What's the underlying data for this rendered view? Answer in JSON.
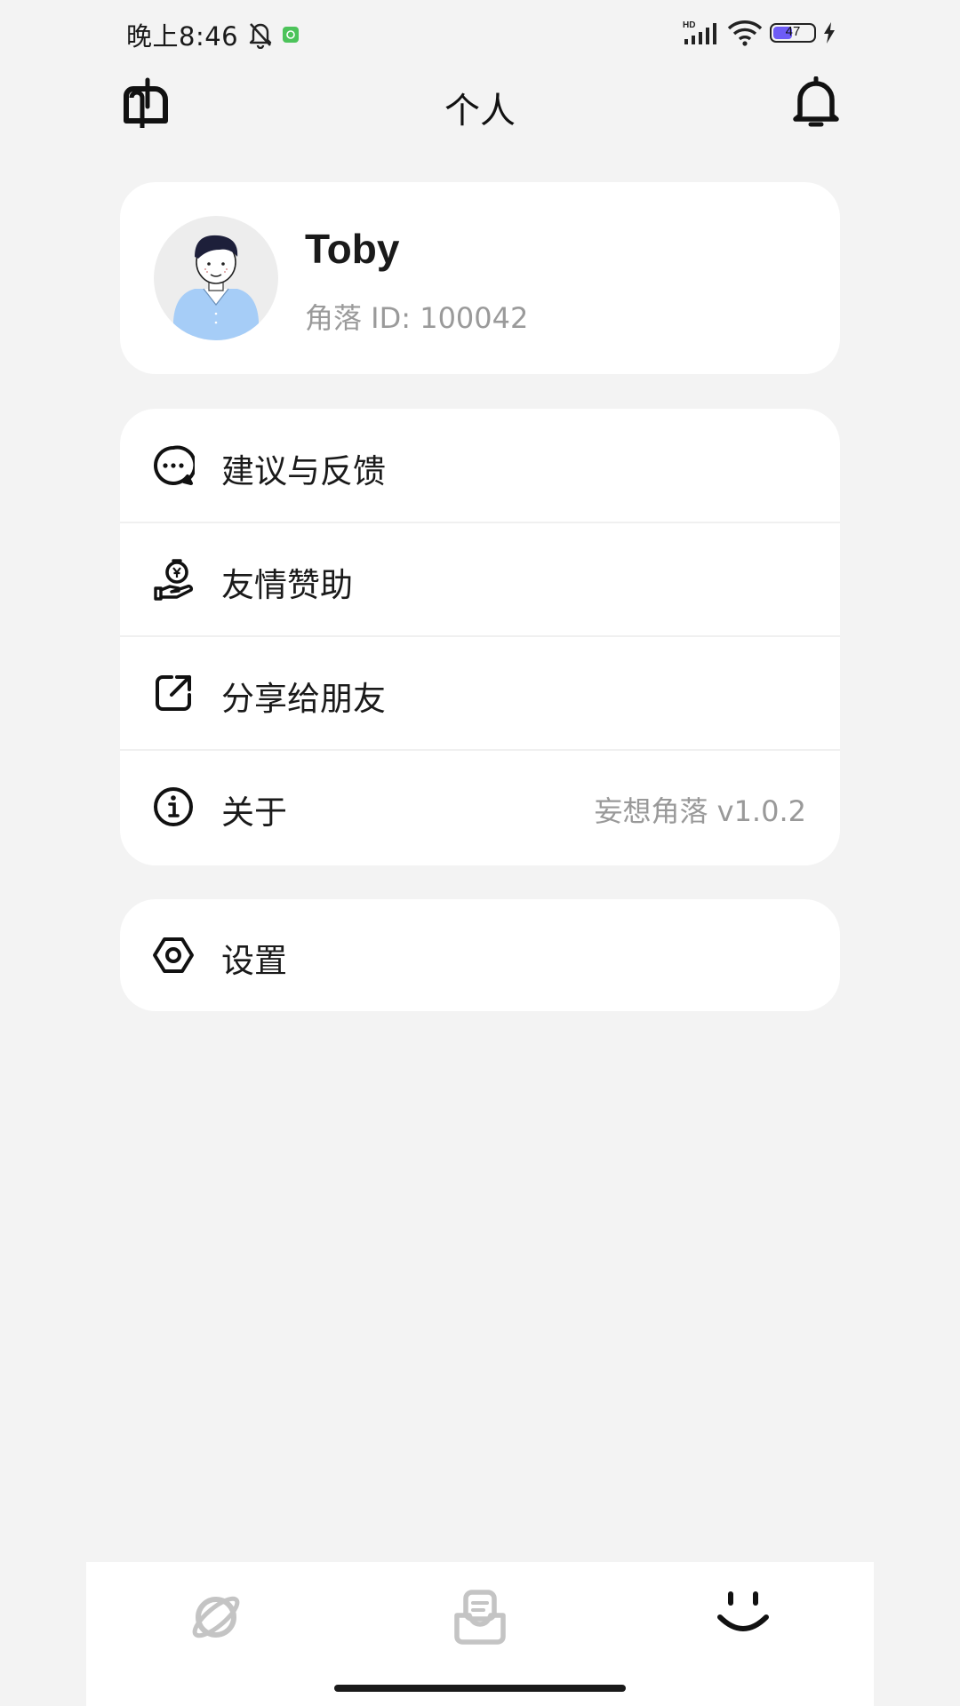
{
  "status_bar": {
    "time": "晚上8:46",
    "network_label": "HD",
    "battery_percent": "47",
    "icons": [
      "mute-bell-icon",
      "app-notification-icon",
      "signal-icon",
      "wifi-icon",
      "battery-icon",
      "charging-icon"
    ]
  },
  "header": {
    "title": "个人",
    "left_icon": "mailbox-icon",
    "right_icon": "bell-icon"
  },
  "profile": {
    "name": "Toby",
    "id_text": "角落 ID: 100042",
    "avatar": "avatar-illustration"
  },
  "menu": {
    "items": [
      {
        "label": "建议与反馈",
        "icon": "chat-bubble-icon"
      },
      {
        "label": "友情赞助",
        "icon": "money-bag-hand-icon"
      },
      {
        "label": "分享给朋友",
        "icon": "share-external-icon"
      },
      {
        "label": "关于",
        "icon": "info-icon",
        "value": "妄想角落 v1.0.2"
      }
    ]
  },
  "settings": {
    "label": "设置",
    "icon": "hex-gear-icon"
  },
  "bottom_nav": {
    "tabs": [
      {
        "name": "planet-tab",
        "icon": "planet-icon",
        "active": false
      },
      {
        "name": "inbox-tab",
        "icon": "inbox-tray-icon",
        "active": false
      },
      {
        "name": "profile-tab",
        "icon": "smile-icon",
        "active": true
      }
    ],
    "colors": {
      "active": "#111111",
      "inactive": "#c4c4c4"
    }
  }
}
